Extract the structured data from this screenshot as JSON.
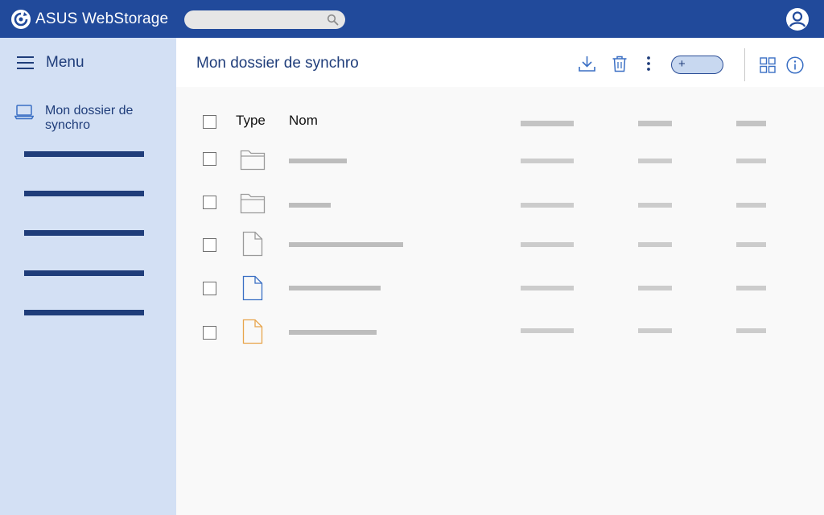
{
  "app": {
    "brand": "ASUS WebStorage"
  },
  "colors": {
    "brand": "#214a9b",
    "sidebar": "#d3e0f4",
    "accent_blue": "#3a6fc4",
    "accent_orange": "#e8a54b"
  },
  "search": {
    "placeholder": ""
  },
  "sidebar": {
    "menu_label": "Menu",
    "sync_folder_label": "Mon dossier de synchro",
    "items": [
      {
        "label": ""
      },
      {
        "label": ""
      },
      {
        "label": ""
      },
      {
        "label": ""
      },
      {
        "label": ""
      }
    ]
  },
  "header": {
    "title": "Mon dossier de synchro",
    "add_label": "+",
    "icons": [
      "download-icon",
      "trash-icon",
      "more-icon",
      "grid-view-icon",
      "info-icon"
    ]
  },
  "table": {
    "columns": {
      "select": "",
      "type": "Type",
      "name": "Nom"
    },
    "rows": [
      {
        "type": "folder"
      },
      {
        "type": "folder"
      },
      {
        "type": "file-gray"
      },
      {
        "type": "file-blue"
      },
      {
        "type": "file-orange"
      }
    ]
  }
}
